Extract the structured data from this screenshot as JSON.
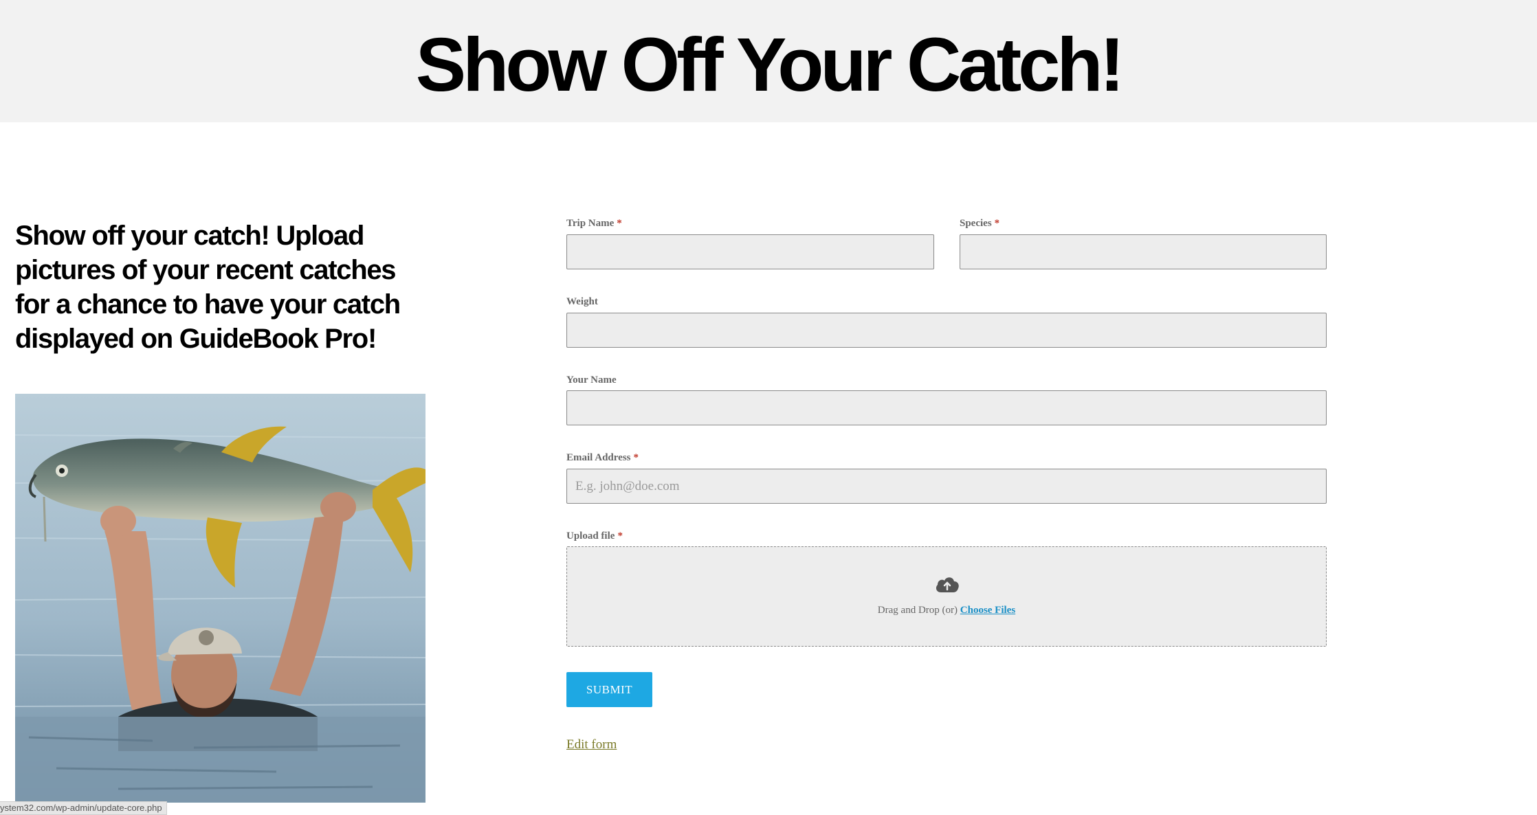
{
  "page": {
    "title": "Show Off Your Catch!",
    "intro": "Show off your catch! Upload pictures of your recent catches for a chance to have your catch displayed on GuideBook Pro!"
  },
  "form": {
    "trip_name": {
      "label": "Trip Name",
      "required_mark": "*",
      "value": ""
    },
    "species": {
      "label": "Species",
      "required_mark": "*",
      "value": ""
    },
    "weight": {
      "label": "Weight",
      "value": ""
    },
    "your_name": {
      "label": "Your Name",
      "value": ""
    },
    "email": {
      "label": "Email Address",
      "required_mark": "*",
      "placeholder": "E.g. john@doe.com",
      "value": ""
    },
    "upload": {
      "label": "Upload file",
      "required_mark": "*",
      "icon": "cloud-upload-icon",
      "text": "Drag and Drop (or)",
      "link": "Choose Files"
    },
    "submit_label": "SUBMIT",
    "edit_link": "Edit form"
  },
  "status_bar": {
    "url": "ystem32.com/wp-admin/update-core.php"
  },
  "colors": {
    "hero_bg": "#f2f2f2",
    "field_bg": "#ededed",
    "required": "#c0392b",
    "submit_bg": "#1ea8e3",
    "link": "#1a8fc6",
    "edit_link": "#7a7a28"
  }
}
